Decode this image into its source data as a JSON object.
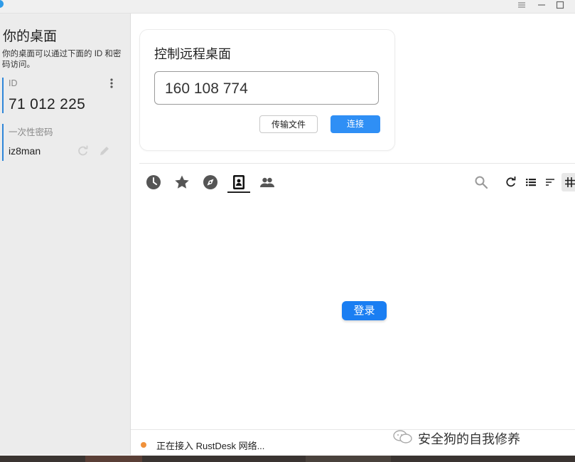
{
  "sidebar": {
    "title": "你的桌面",
    "description": "你的桌面可以通过下面的 ID 和密码访问。",
    "id_label": "ID",
    "id_value": "71 012 225",
    "password_label": "一次性密码",
    "password_value": "iz8man",
    "icons": [
      "more-vert-icon",
      "refresh-icon",
      "edit-icon"
    ]
  },
  "control": {
    "title": "控制远程桌面",
    "id_input_value": "160 108 774",
    "transfer_button": "传输文件",
    "connect_button": "连接"
  },
  "tabs": [
    "recent-history-icon",
    "favorites-star-icon",
    "discovered-compass-icon",
    "address-book-icon",
    "group-icon"
  ],
  "active_tab": "address-book-icon",
  "toolbar_icons": [
    "search-icon",
    "refresh-icon",
    "list-view-icon",
    "sort-icon",
    "grid-view-icon"
  ],
  "login_button": "登录",
  "status": {
    "text": "正在接入 RustDesk 网络...",
    "indicator_color": "#f0913a"
  },
  "watermark": "安全狗的自我修养",
  "colors": {
    "accent": "#2f8ff5",
    "login": "#1a7ef2",
    "sidebar_bg": "#ececec"
  }
}
